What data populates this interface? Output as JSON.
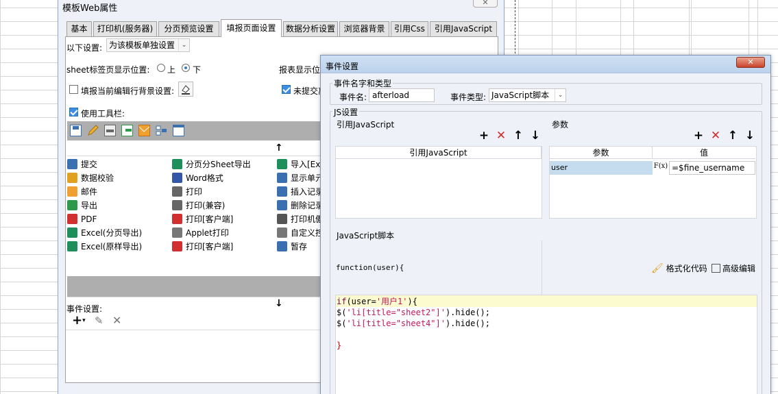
{
  "main_dialog": {
    "title": "模板Web属性",
    "close_label": "✕",
    "tabs": [
      {
        "label": "基本"
      },
      {
        "label": "打印机(服务器)"
      },
      {
        "label": "分页预览设置"
      },
      {
        "label": "填报页面设置"
      },
      {
        "label": "数据分析设置"
      },
      {
        "label": "浏览器背景"
      },
      {
        "label": "引用Css"
      },
      {
        "label": "引用JavaScript"
      }
    ],
    "active_tab": "填报页面设置",
    "settings_label": "以下设置:",
    "settings_value": "为该模板单独设置",
    "sheet_position_label": "sheet标签页显示位置:",
    "radio_top": "上",
    "radio_bottom": "下",
    "report_display_label": "报表显示位",
    "fill_bg_label": "填报当前编辑行背景设置:",
    "unsubmitted_label": "未提交离",
    "use_toolbar_label": "使用工具栏:",
    "toolbar_list": [
      {
        "label": "提交",
        "icon": "save-icon",
        "color": "#3a6fb0"
      },
      {
        "label": "分页分Sheet导出",
        "icon": "excel-icon",
        "color": "#1e8f5b"
      },
      {
        "label": "导入[Ex",
        "icon": "excel-icon",
        "color": "#1e8f5b"
      },
      {
        "label": "数据校验",
        "icon": "pencil-icon",
        "color": "#e0a020"
      },
      {
        "label": "Word格式",
        "icon": "word-icon",
        "color": "#3357a6"
      },
      {
        "label": "显示单元",
        "icon": "cell-icon",
        "color": "#3a6fb0"
      },
      {
        "label": "邮件",
        "icon": "mail-icon",
        "color": "#f0a030"
      },
      {
        "label": "打印",
        "icon": "print-icon",
        "color": "#666666"
      },
      {
        "label": "插入记录",
        "icon": "insert-row-icon",
        "color": "#3a6fb0"
      },
      {
        "label": "导出",
        "icon": "export-icon",
        "color": "#2d9a4a"
      },
      {
        "label": "打印(兼容)",
        "icon": "print-icon",
        "color": "#666666"
      },
      {
        "label": "删除记录",
        "icon": "delete-row-icon",
        "color": "#3a6fb0"
      },
      {
        "label": "PDF",
        "icon": "pdf-icon",
        "color": "#d03030"
      },
      {
        "label": "打印[客户端]",
        "icon": "pdf-print-icon",
        "color": "#d03030"
      },
      {
        "label": "打印机傲",
        "icon": "move-icon",
        "color": "#555555"
      },
      {
        "label": "Excel(分页导出)",
        "icon": "excel-icon",
        "color": "#1e8f5b"
      },
      {
        "label": "Applet打印",
        "icon": "applet-print-icon",
        "color": "#777777"
      },
      {
        "label": "自定义控",
        "icon": "gear-icon",
        "color": "#777777"
      },
      {
        "label": "Excel(原样导出)",
        "icon": "excel-icon",
        "color": "#1e8f5b"
      },
      {
        "label": "打印[客户端]",
        "icon": "pdf-print-icon",
        "color": "#d03030"
      },
      {
        "label": "暂存",
        "icon": "save-icon",
        "color": "#3a6fb0"
      }
    ],
    "arrow_up": "↑",
    "arrow_down": "↓",
    "event_settings_label": "事件设置:",
    "event_add": "+",
    "event_add_caret": "▾",
    "event_edit": "✎",
    "event_delete": "✕"
  },
  "event_dialog": {
    "title": "事件设置",
    "close_label": "✕",
    "name_group_title": "事件名字和类型",
    "event_name_label": "事件名:",
    "event_name_value": "afterload",
    "event_type_label": "事件类型:",
    "event_type_value": "JavaScript脚本",
    "js_group_title": "JS设置",
    "ref_js_label": "引用JavaScript",
    "ref_js_column": "引用JavaScript",
    "params_label": "参数",
    "params_columns": {
      "param": "参数",
      "value": "值"
    },
    "params_rows": [
      {
        "name": "user",
        "formula_icon": "F(x)",
        "value": "=$fine_username"
      }
    ],
    "buttons": {
      "add": "+",
      "delete": "✕",
      "up": "↑",
      "down": "↓"
    },
    "js_script_label": "JavaScript脚本",
    "function_signature": "function(user){",
    "format_code_label": "格式化代码",
    "advanced_edit_label": "高级编辑",
    "code_lines": [
      "if(user='用户1'){",
      "$('li[title=\"sheet2\"]').hide();",
      "$('li[title=\"sheet4\"]').hide();",
      "",
      "}"
    ]
  }
}
